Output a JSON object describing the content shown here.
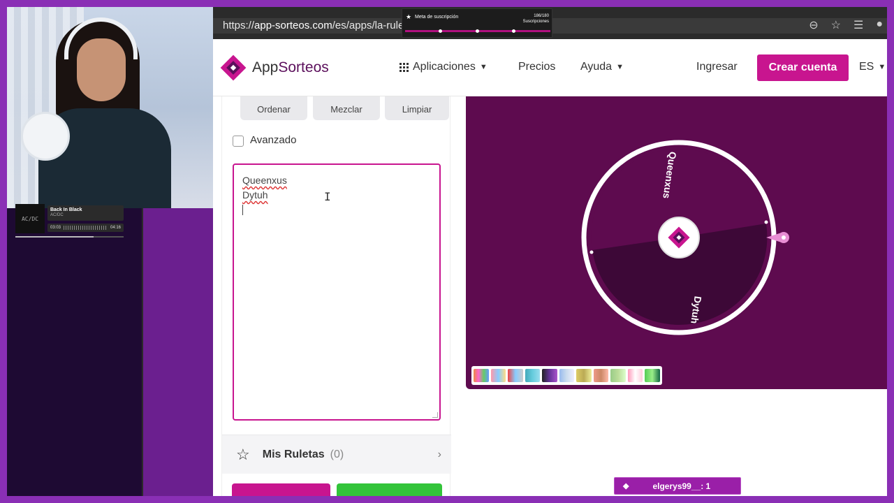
{
  "browser": {
    "url_prefix": "https://",
    "url_host": "app-sorteos.com",
    "url_path": "/es/apps/la-rule",
    "icons": [
      "more-icon",
      "star-icon",
      "bookmarks-icon",
      "profile-icon"
    ]
  },
  "stream_overlay": {
    "goal_label": "Meta de suscripción",
    "goal_count": "186/180",
    "goal_unit": "Suscripciones",
    "music_title": "Back In Black",
    "music_artist": "AC/DC",
    "music_elapsed": "03:03",
    "music_total": "04:16",
    "music_progress": 0.72,
    "notification": "elgerys99__: 1"
  },
  "header": {
    "logo_prefix": "App",
    "logo_suffix": "Sorteos",
    "nav_apps": "Aplicaciones",
    "nav_prices": "Precios",
    "nav_help": "Ayuda",
    "login": "Ingresar",
    "create_account": "Crear cuenta",
    "language": "ES"
  },
  "panel": {
    "tools": [
      "Ordenar",
      "Mezclar",
      "Limpiar"
    ],
    "advanced_label": "Avanzado",
    "entries": [
      "Queenxus",
      "Dytuh"
    ],
    "my_wheels_label": "Mis Ruletas",
    "my_wheels_count": "(0)"
  },
  "wheel": {
    "segments": [
      "Queenxus",
      "Dytuh"
    ],
    "colors": {
      "background": "#5e0b4f",
      "segment_a": "#5e0b4f",
      "segment_b": "#3d0837",
      "rim": "#ffffff",
      "pointer": "#e88ed4"
    }
  },
  "palette_count": 11,
  "colors": {
    "accent": "#c8158f",
    "brand": "#5b0f5b",
    "green_button": "#33c43a"
  }
}
